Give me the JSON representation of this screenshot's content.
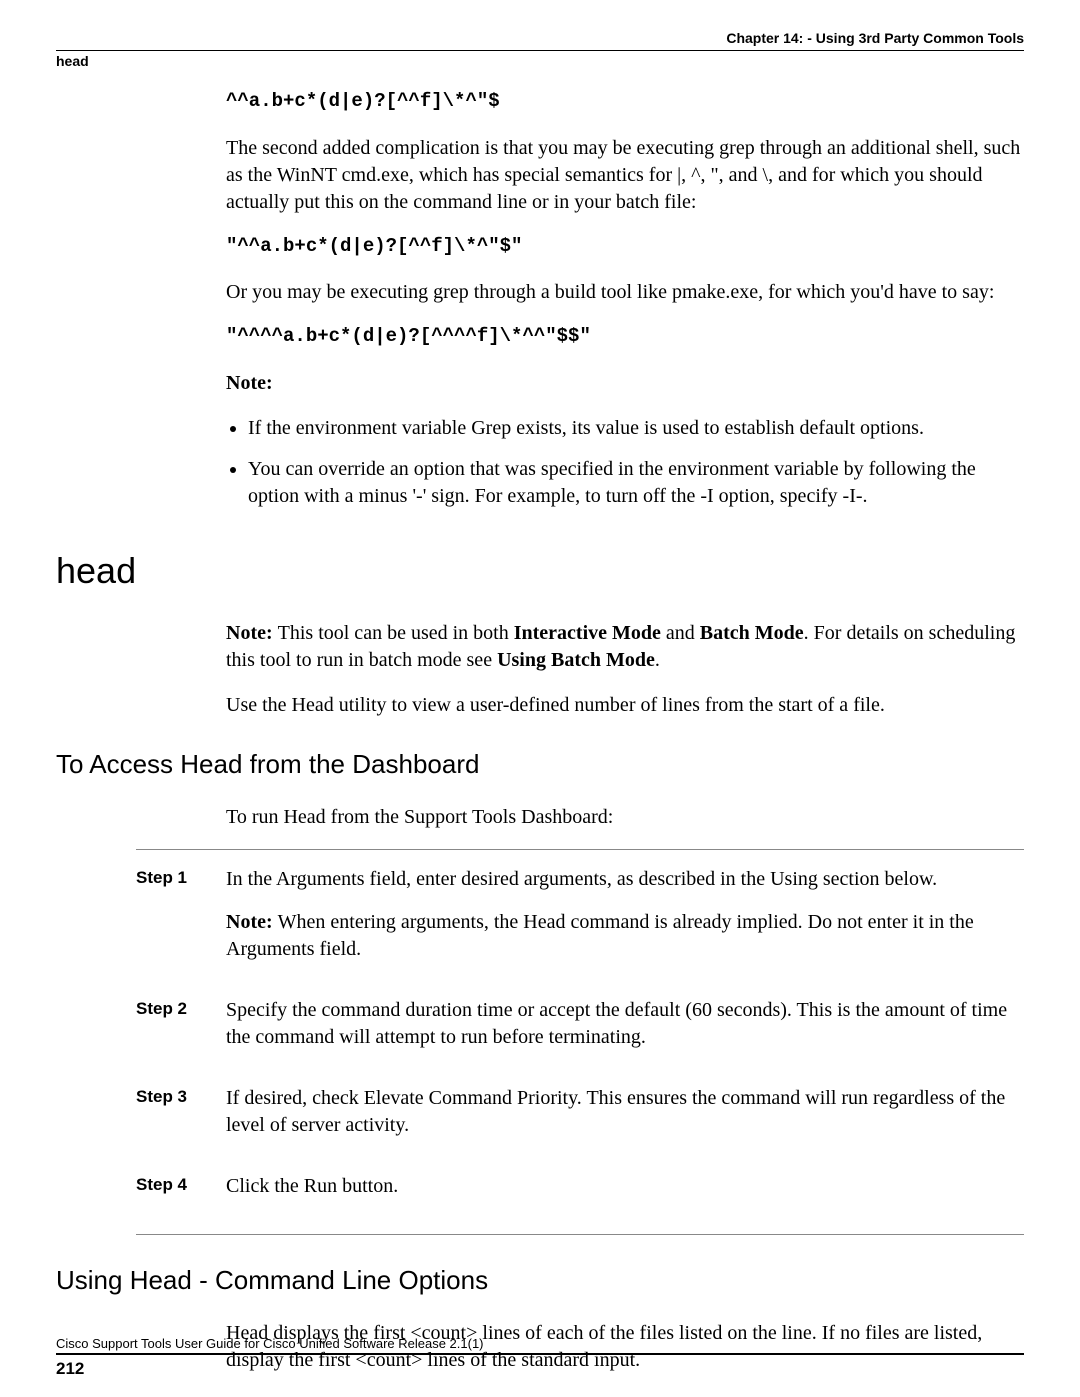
{
  "header": {
    "chapter": "Chapter 14: - Using 3rd Party Common Tools",
    "running": "head"
  },
  "grep_continued": {
    "code1": "^^a.b+c*(d|e)?[^^f]\\*^\"$",
    "para1": "The second added complication is that you may be executing grep through an additional shell, such as the WinNT cmd.exe, which has special semantics for |, ^, \", and \\, and for which you should actually put this on the command line or in your batch file:",
    "code2": "\"^^a.b+c*(d|e)?[^^f]\\*^\"$\"",
    "para2": "Or you may be executing grep through a build tool like pmake.exe, for which you'd have to say:",
    "code3": "\"^^^^a.b+c*(d|e)?[^^^^f]\\*^^\"$$\"",
    "note_label": "Note:",
    "bullet1": "If the environment variable Grep exists, its value is used to establish default options.",
    "bullet2": "You can override an option that was specified in the environment variable by following the option with a minus '-' sign. For example, to turn off the -I option, specify -I-."
  },
  "head_section": {
    "title": "head",
    "note_prefix": "Note: ",
    "note_mid1": "This tool can be used in both ",
    "note_bold1": "Interactive Mode",
    "note_mid2": " and ",
    "note_bold2": "Batch Mode",
    "note_mid3": ". For details on scheduling this tool to run in batch mode see ",
    "note_bold3": "Using Batch Mode",
    "note_end": ".",
    "para2": "Use the Head utility to view a user-defined number of lines from the start of a file."
  },
  "access_section": {
    "title": "To Access Head from the Dashboard",
    "intro": "To run Head from the Support Tools Dashboard:",
    "steps": [
      {
        "label": "Step 1",
        "text1": "In the Arguments field, enter desired arguments, as described in the Using section below.",
        "note_prefix": "Note: ",
        "note_text": "When entering arguments, the Head command is already implied. Do not enter it in the Arguments field."
      },
      {
        "label": "Step 2",
        "text1": "Specify the command duration time or accept the default (60 seconds). This is the amount of time the command will attempt to run before terminating."
      },
      {
        "label": "Step 3",
        "text1": "If desired, check Elevate Command Priority. This ensures the command will run regardless of the level of server activity."
      },
      {
        "label": "Step 4",
        "text1": "Click the Run button."
      }
    ]
  },
  "using_section": {
    "title": "Using Head - Command Line Options",
    "para1": "Head displays the first <count> lines of each of the files listed on the line. If no files are listed, display the first <count> lines of the standard input."
  },
  "footer": {
    "text": "Cisco Support Tools User Guide for Cisco Unified Software Release 2.1(1)",
    "page": "212"
  }
}
